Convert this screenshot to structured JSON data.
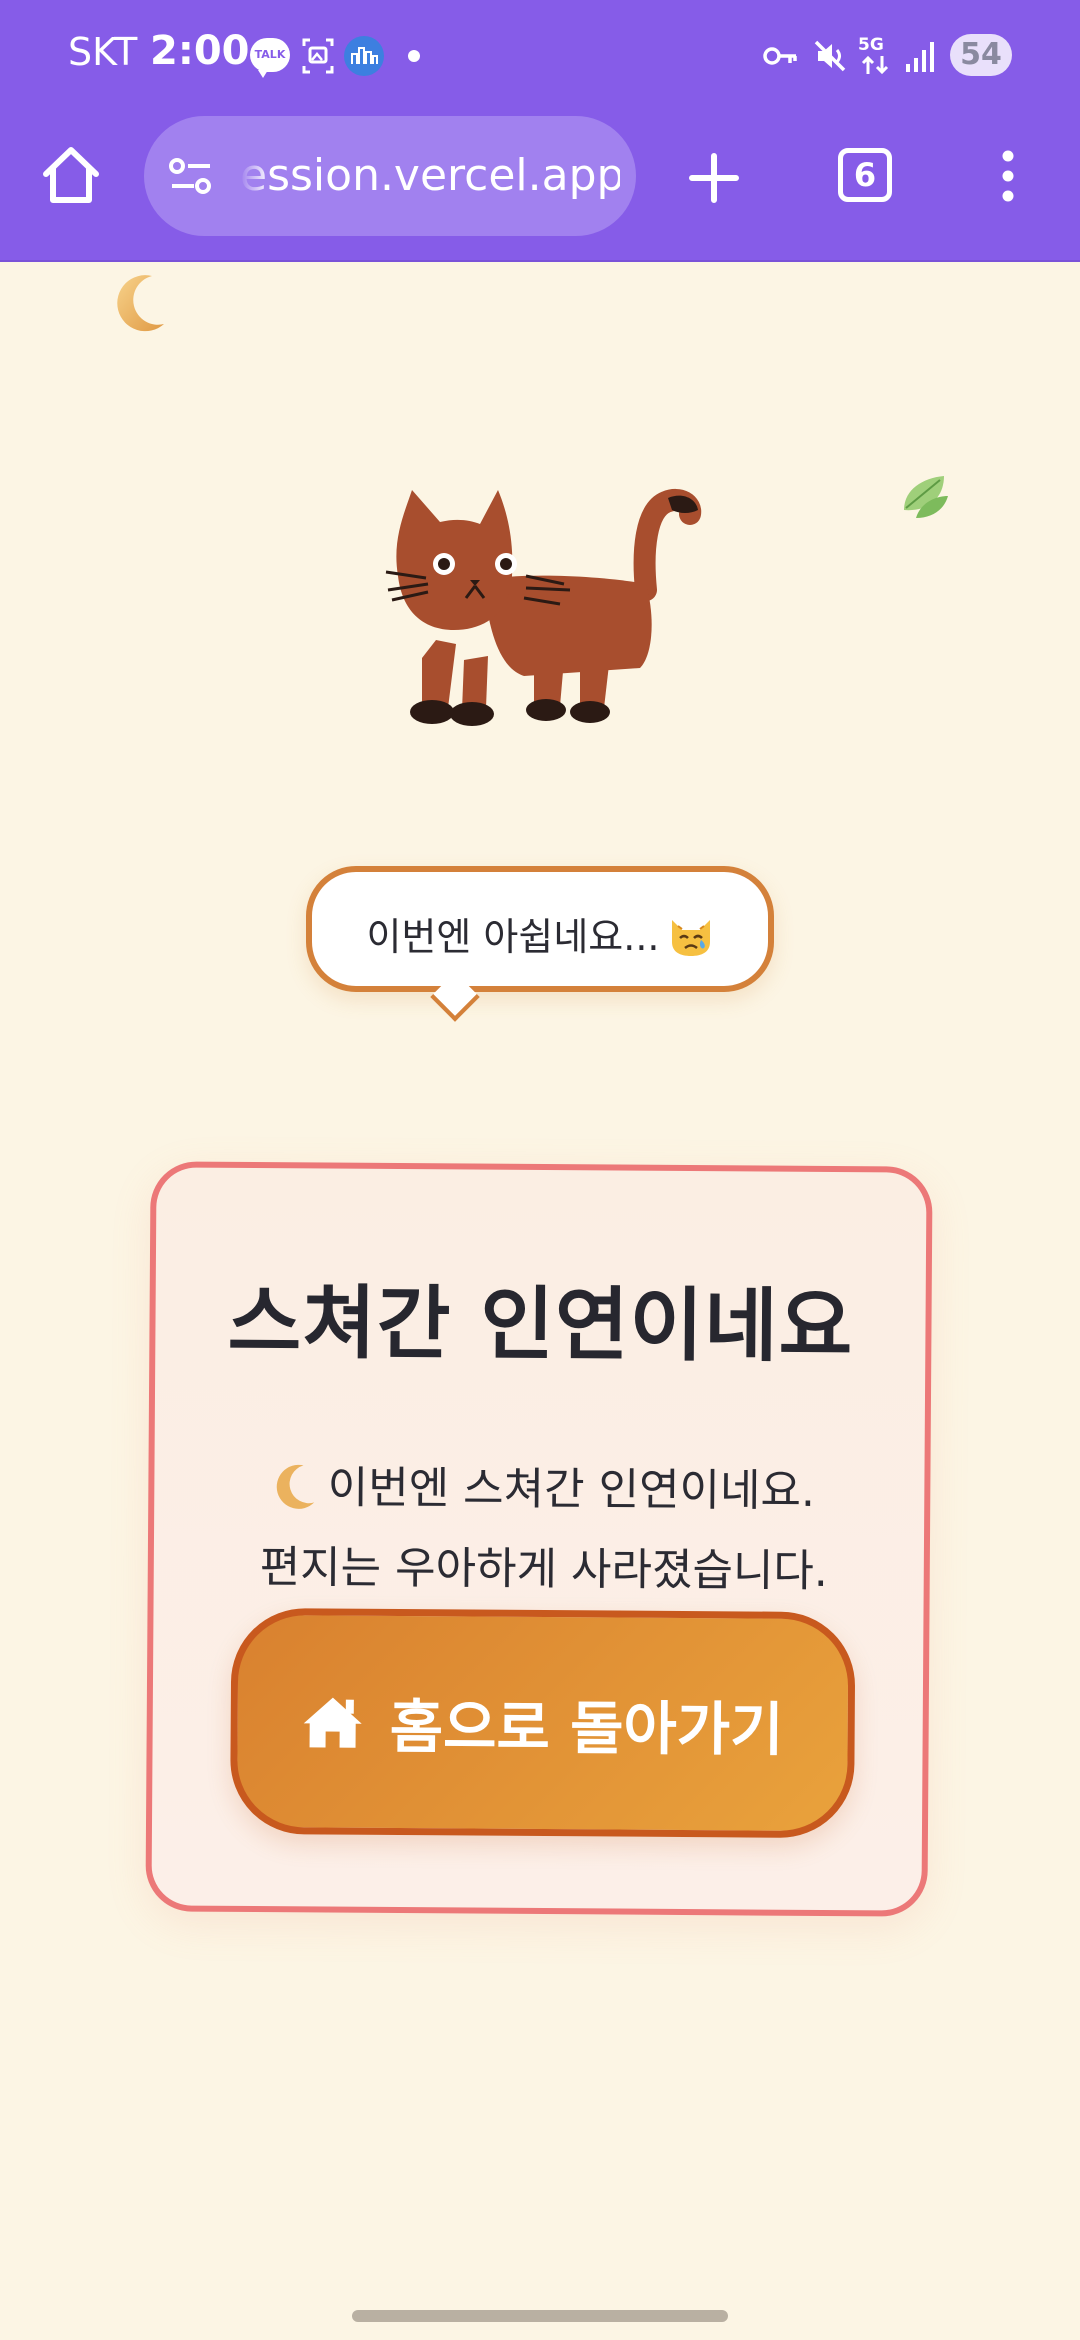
{
  "status_bar": {
    "carrier": "SKT",
    "time": "2:00",
    "talk_badge": "TALK",
    "network": "5G",
    "battery": "54"
  },
  "browser": {
    "url": "ession.vercel.app",
    "tab_count": "6"
  },
  "bubble": {
    "text": "이번엔 아쉽네요..."
  },
  "card": {
    "title": "스쳐간 인연이네요",
    "message_line1": "이번엔 스쳐간 인연이네요.",
    "message_line2": "편지는 우아하게 사라졌습니다.",
    "button_label": "홈으로 돌아가기"
  },
  "colors": {
    "browser_chrome": "#865ce8",
    "page_background": "#fcf5e4",
    "card_border": "#ec7878",
    "button_fill": "#e09035",
    "button_border": "#c8591e",
    "bubble_border": "#d4813a"
  },
  "icons": {
    "status": [
      "talk-icon",
      "screenshot-icon",
      "city-app-icon",
      "dot-icon",
      "vpn-key-icon",
      "mute-icon",
      "5g-icon",
      "signal-icon",
      "battery-icon"
    ],
    "toolbar": [
      "home-icon",
      "site-settings-icon",
      "plus-icon",
      "tabs-icon",
      "more-vert-icon"
    ],
    "page": [
      "moon-icon",
      "leaf-icon",
      "cat-illustration",
      "crying-cat-emoji",
      "house-icon"
    ]
  }
}
